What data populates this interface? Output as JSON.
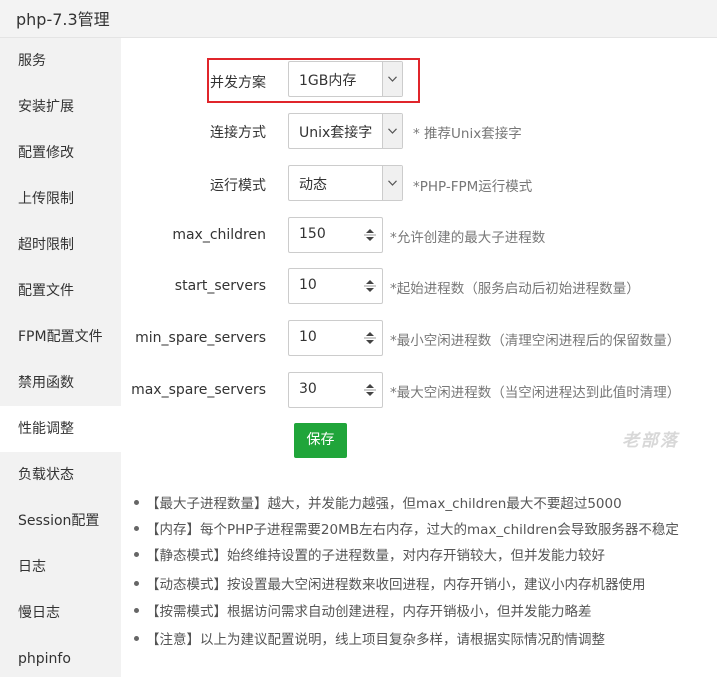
{
  "window": {
    "title": "php-7.3管理"
  },
  "sidebar": {
    "items": [
      {
        "label": "服务"
      },
      {
        "label": "安装扩展"
      },
      {
        "label": "配置修改"
      },
      {
        "label": "上传限制"
      },
      {
        "label": "超时限制"
      },
      {
        "label": "配置文件"
      },
      {
        "label": "FPM配置文件"
      },
      {
        "label": "禁用函数"
      },
      {
        "label": "性能调整",
        "active": true
      },
      {
        "label": "负载状态"
      },
      {
        "label": "Session配置"
      },
      {
        "label": "日志"
      },
      {
        "label": "慢日志"
      },
      {
        "label": "phpinfo"
      }
    ]
  },
  "form": {
    "concurrency": {
      "label": "并发方案",
      "value": "1GB内存"
    },
    "connection": {
      "label": "连接方式",
      "value": "Unix套接字",
      "hint": "* 推荐Unix套接字"
    },
    "run_mode": {
      "label": "运行模式",
      "value": "动态",
      "hint": "*PHP-FPM运行模式"
    },
    "max_children": {
      "label": "max_children",
      "value": "150",
      "hint": "*允许创建的最大子进程数"
    },
    "start_servers": {
      "label": "start_servers",
      "value": "10",
      "hint": "*起始进程数（服务启动后初始进程数量）"
    },
    "min_spare_servers": {
      "label": "min_spare_servers",
      "value": "10",
      "hint": "*最小空闲进程数（清理空闲进程后的保留数量）"
    },
    "max_spare_servers": {
      "label": "max_spare_servers",
      "value": "30",
      "hint": "*最大空闲进程数（当空闲进程达到此值时清理）"
    },
    "save_label": "保存"
  },
  "watermark": "老部落",
  "notes": [
    "【最大子进程数量】越大，并发能力越强，但max_children最大不要超过5000",
    "【内存】每个PHP子进程需要20MB左右内存，过大的max_children会导致服务器不稳定",
    "【静态模式】始终维持设置的子进程数量，对内存开销较大，但并发能力较好",
    "【动态模式】按设置最大空闲进程数来收回进程，内存开销小，建议小内存机器使用",
    "【按需模式】根据访问需求自动创建进程，内存开销极小，但并发能力略差",
    "【注意】以上为建议配置说明，线上项目复杂多样，请根据实际情况酌情调整"
  ],
  "colors": {
    "accent": "#20a53a",
    "highlight_border": "#e0252b",
    "sidebar_bg": "#f2f2f2"
  }
}
